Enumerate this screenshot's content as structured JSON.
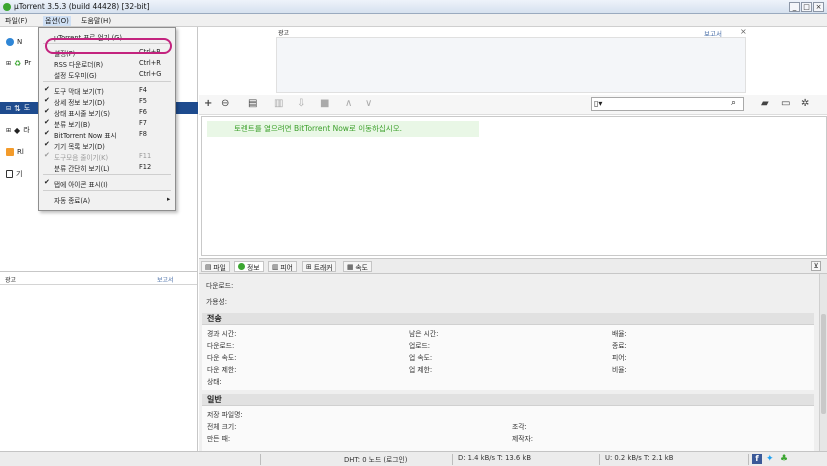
{
  "window": {
    "title": "µTorrent 3.5.3  (build 44428) [32-bit]",
    "buttons": [
      "_",
      "□",
      "×"
    ]
  },
  "menubar": {
    "items": [
      "파일(F)",
      "옵션(O)",
      "도움말(H)"
    ]
  },
  "sidebar": {
    "items": [
      {
        "label": "N",
        "icon": "globe-icon"
      },
      {
        "label": "Pr",
        "icon": "rss-icon"
      },
      {
        "label": "도",
        "icon": "download-icon"
      },
      {
        "label": "라",
        "icon": "label-icon"
      },
      {
        "label": "Rl",
        "icon": "rss-icon"
      },
      {
        "label": "기",
        "icon": "device-icon"
      }
    ],
    "bottom_label": "광고",
    "bottom_report": "보고서"
  },
  "options_menu": {
    "items": [
      {
        "label": "µTorrent 프로 얻기 (G)",
        "shortcut": "",
        "check": false,
        "disabled": false
      },
      {
        "label": "설정(P)",
        "shortcut": "Ctrl+P",
        "check": false,
        "disabled": false
      },
      {
        "label": "RSS 다운로더(R)",
        "shortcut": "Ctrl+R",
        "check": false,
        "disabled": false
      },
      {
        "label": "설정 도우미(G)",
        "shortcut": "Ctrl+G",
        "check": false,
        "disabled": false
      },
      {
        "label": "도구 막대 보기(T)",
        "shortcut": "F4",
        "check": true,
        "disabled": false
      },
      {
        "label": "상세 정보 보기(D)",
        "shortcut": "F5",
        "check": true,
        "disabled": false
      },
      {
        "label": "상태 표시줄 보기(S)",
        "shortcut": "F6",
        "check": true,
        "disabled": false
      },
      {
        "label": "분류 보기(B)",
        "shortcut": "F7",
        "check": true,
        "disabled": false
      },
      {
        "label": "BitTorrent Now 표시",
        "shortcut": "F8",
        "check": true,
        "disabled": false
      },
      {
        "label": "기기 목록 보기(D)",
        "shortcut": "",
        "check": true,
        "disabled": false
      },
      {
        "label": "도구모음 줄이기(K)",
        "shortcut": "F11",
        "check": true,
        "disabled": true
      },
      {
        "label": "분류 간단히 보기(L)",
        "shortcut": "F12",
        "check": false,
        "disabled": false
      },
      {
        "label": "탭에 아이콘 표시(I)",
        "shortcut": "",
        "check": true,
        "disabled": false
      },
      {
        "label": "자동 종료(A)",
        "shortcut": "▸",
        "check": false,
        "disabled": false
      }
    ]
  },
  "ad": {
    "label": "광고",
    "report": "보고서",
    "close": "×"
  },
  "toolbar": {
    "search_placeholder": ""
  },
  "notice": "토렌트를 열으려면 BitTorrent Now로 이동하십시오.",
  "tabs": [
    {
      "label": "파일",
      "icon": "file-icon"
    },
    {
      "label": "정보",
      "icon": "info-icon"
    },
    {
      "label": "피어",
      "icon": "peers-icon"
    },
    {
      "label": "트래커",
      "icon": "tracker-icon"
    },
    {
      "label": "속도",
      "icon": "speed-icon"
    }
  ],
  "details": {
    "download_label": "다운로드:",
    "availability_label": "가용성:",
    "transfer": {
      "title": "전송",
      "col1": [
        "경과 시간:",
        "다운로드:",
        "다운 속도:",
        "다운 제한:",
        "상태:"
      ],
      "col2": [
        "남은 시간:",
        "업로드:",
        "업 속도:",
        "업 제한:"
      ],
      "col3": [
        "배율:",
        "종료:",
        "피어:",
        "비율:"
      ]
    },
    "general": {
      "title": "일반",
      "col1": [
        "저장 파일명:",
        "전체 크기:",
        "만든 때:"
      ],
      "col2": [
        "조각:",
        "제작자:"
      ]
    }
  },
  "statusbar": {
    "dht": "DHT: 0 노드  (로그인)",
    "down": "D: 1.4 kB/s T: 13.6 kB",
    "up": "U: 0.2 kB/s T: 2.1 kB"
  },
  "colors": {
    "accent": "#1e4b8e",
    "notice_text": "#3a9f29",
    "highlight": "#c3237e"
  }
}
